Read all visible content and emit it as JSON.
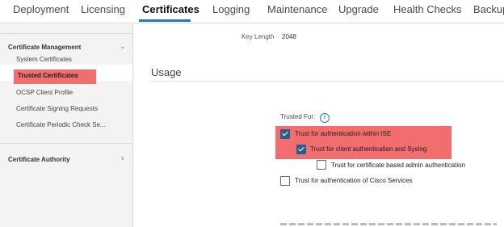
{
  "top_nav": {
    "tabs": [
      "Deployment",
      "Licensing",
      "Certificates",
      "Logging",
      "Maintenance",
      "Upgrade",
      "Health Checks",
      "Backup"
    ],
    "active": "Certificates"
  },
  "sidebar": {
    "cert_mgmt": {
      "title": "Certificate Management",
      "items": [
        "System Certificates",
        "Trusted Certificates",
        "OCSP Client Profile",
        "Certificate Signing Requests",
        "Certificate Periodic Check Se..."
      ],
      "selected": "Trusted Certificates"
    },
    "cert_authority": {
      "title": "Certificate Authority"
    }
  },
  "main": {
    "key_length": {
      "label": "Key Length",
      "value": "2048"
    },
    "usage": {
      "title": "Usage",
      "trusted_for_label": "Trusted For:",
      "info_glyph": "i",
      "options": [
        {
          "label": "Trust for authentication within ISE",
          "checked": true
        },
        {
          "label": "Trust for client authentication and Syslog",
          "checked": true
        },
        {
          "label": "Trust for certificate based admin authentication",
          "checked": false
        },
        {
          "label": "Trust for authentication of Cisco Services",
          "checked": false
        }
      ]
    }
  },
  "colors": {
    "accent": "#1e7bc2",
    "highlight": "#f26d6d",
    "checkbox_checked": "#2a5d8f"
  }
}
